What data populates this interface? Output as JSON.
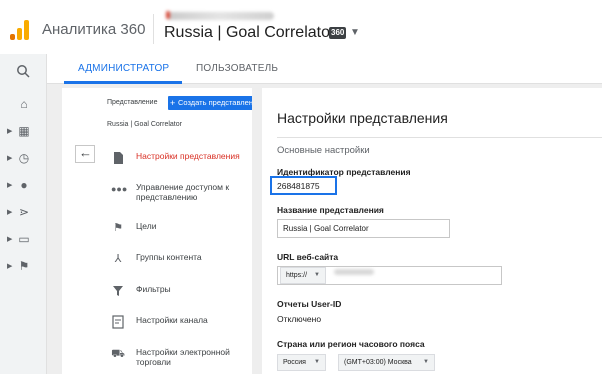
{
  "header": {
    "brand": "Аналитика 360",
    "view_name": "Russia | Goal Correlator",
    "view_badge": "360"
  },
  "tabs": [
    {
      "label": "АДМИНИСТРАТОР",
      "active": true
    },
    {
      "label": "ПОЛЬЗОВАТЕЛЬ",
      "active": false
    }
  ],
  "rail": {
    "items": [
      "home-icon",
      "dashboard-icon",
      "clock-icon",
      "person-icon",
      "acquisition-icon",
      "behavior-icon",
      "flag-icon"
    ]
  },
  "panel": {
    "crumb": "Представление",
    "create_button": "Создать представление",
    "crumb_view": "Russia | Goal Correlator",
    "items": [
      {
        "label": "Настройки представления",
        "icon": "document-icon",
        "active": true
      },
      {
        "label": "Управление доступом к представлению",
        "icon": "people-icon",
        "active": false
      },
      {
        "label": "Цели",
        "icon": "flag-icon",
        "active": false
      },
      {
        "label": "Группы контента",
        "icon": "content-group-icon",
        "active": false
      },
      {
        "label": "Фильтры",
        "icon": "filter-icon",
        "active": false
      },
      {
        "label": "Настройки канала",
        "icon": "channel-icon",
        "active": false
      },
      {
        "label": "Настройки электронной торговли",
        "icon": "cart-icon",
        "active": false
      }
    ]
  },
  "settings": {
    "title": "Настройки представления",
    "section": "Основные настройки",
    "view_id_label": "Идентификатор представления",
    "view_id": "268481875",
    "view_name_label": "Название представления",
    "view_name_value": "Russia | Goal Correlator",
    "url_label": "URL веб-сайта",
    "url_protocol": "https://",
    "user_id_label": "Отчеты User-ID",
    "user_id_value": "Отключено",
    "tz_label": "Страна или регион часового пояса",
    "country": "Россия",
    "timezone": "(GMT+03:00) Москва"
  },
  "colors": {
    "accent": "#1a73e8",
    "active_item": "#d93025",
    "logo_orange": "#f9ab00",
    "logo_dark": "#e37400"
  }
}
